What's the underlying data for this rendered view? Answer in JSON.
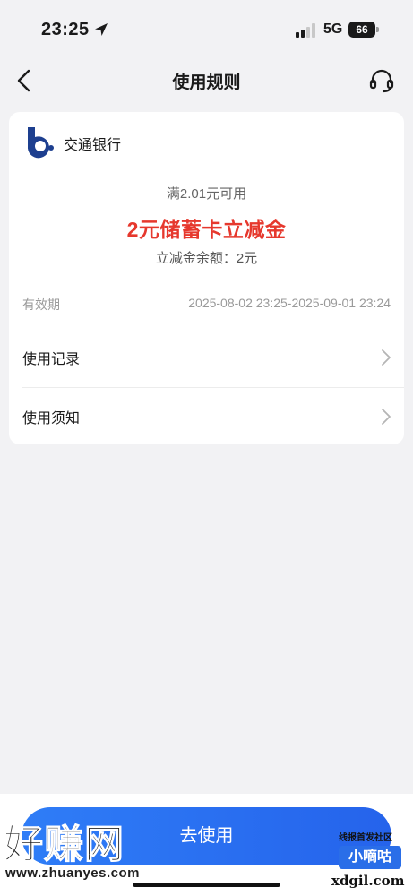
{
  "status_bar": {
    "time": "23:25",
    "network": "5G",
    "battery": "66"
  },
  "nav": {
    "title": "使用规则"
  },
  "card": {
    "bank_name": "交通银行",
    "condition": "满2.01元可用",
    "coupon_title": "2元储蓄卡立减金",
    "balance": "立减金余额：2元",
    "validity_label": "有效期",
    "validity_value": "2025-08-02 23:25-2025-09-01 23:24",
    "rows": [
      {
        "label": "使用记录"
      },
      {
        "label": "使用须知"
      }
    ]
  },
  "bottom": {
    "use_button": "去使用"
  },
  "watermarks": {
    "left_big": "好赚网",
    "left_url": "www.zhuanyes.com",
    "right_top": "线报首发社区",
    "right_badge": "小嘀咕",
    "right_url": "xdgil.com"
  },
  "colors": {
    "accent": "#2f7df7",
    "coupon_red": "#e6382d",
    "bank_logo_navy": "#1d3f8f"
  },
  "icons": [
    "location-arrow-icon",
    "signal-icon",
    "battery-icon",
    "back-chevron-icon",
    "headset-icon",
    "bank-logo-icon",
    "chevron-right-icon"
  ]
}
